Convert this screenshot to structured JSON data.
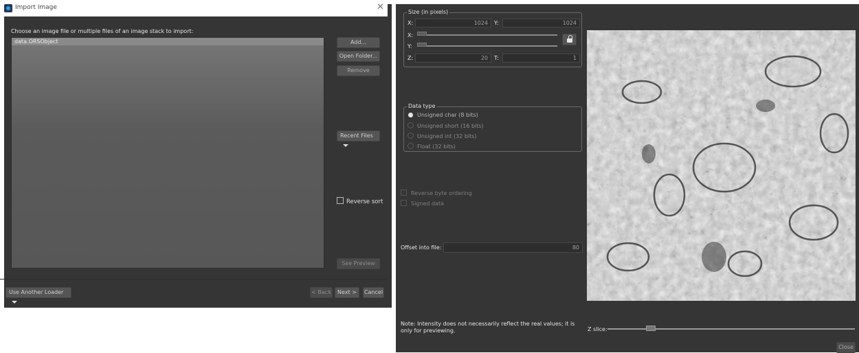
{
  "dialog": {
    "title": "Import Image",
    "instruction": "Choose an image file or multiple files of an image stack to import:",
    "files": [
      "data.ORSObject"
    ],
    "buttons": {
      "add": "Add...",
      "open_folder": "Open Folder...",
      "remove": "Remove",
      "recent_files": "Recent Files",
      "reverse_sort": "Reverse sort",
      "see_preview": "See Preview"
    },
    "footer": {
      "use_another_loader": "Use Another Loader",
      "back": "< Back",
      "next": "Next >",
      "cancel": "Cancel"
    }
  },
  "settings": {
    "size": {
      "title": "Size (in pixels)",
      "x_label": "X:",
      "x_value": "1024",
      "y_label": "Y:",
      "y_value": "1024",
      "slider_x_label": "X:",
      "slider_y_label": "Y:",
      "z_label": "Z:",
      "z_value": "20",
      "t_label": "T:",
      "t_value": "1"
    },
    "data_type": {
      "title": "Data type",
      "options": [
        "Unsigned char (8 bits)",
        "Unsigned short (16 bits)",
        "Unsigned int (32 bits)",
        "Float (32 bits)"
      ],
      "selected": "Unsigned char (8 bits)"
    },
    "reverse_byte_ordering": "Reverse byte ordering",
    "signed_data": "Signed data",
    "offset_label": "Offset into file:",
    "offset_value": "80",
    "note": "Note: Intensity does not necessarily reflect the real values; it is only for previewing.",
    "z_slice_label": "Z slice:",
    "close": "Close"
  },
  "icons": {
    "app": "app-icon",
    "close": "close-icon",
    "lock": "unlocked-padlock-icon",
    "dropdown": "chevron-down-icon"
  },
  "colors": {
    "panel_bg": "#353535",
    "list_bg": "#5b5b5b",
    "selected_row": "#8a8a8a"
  }
}
